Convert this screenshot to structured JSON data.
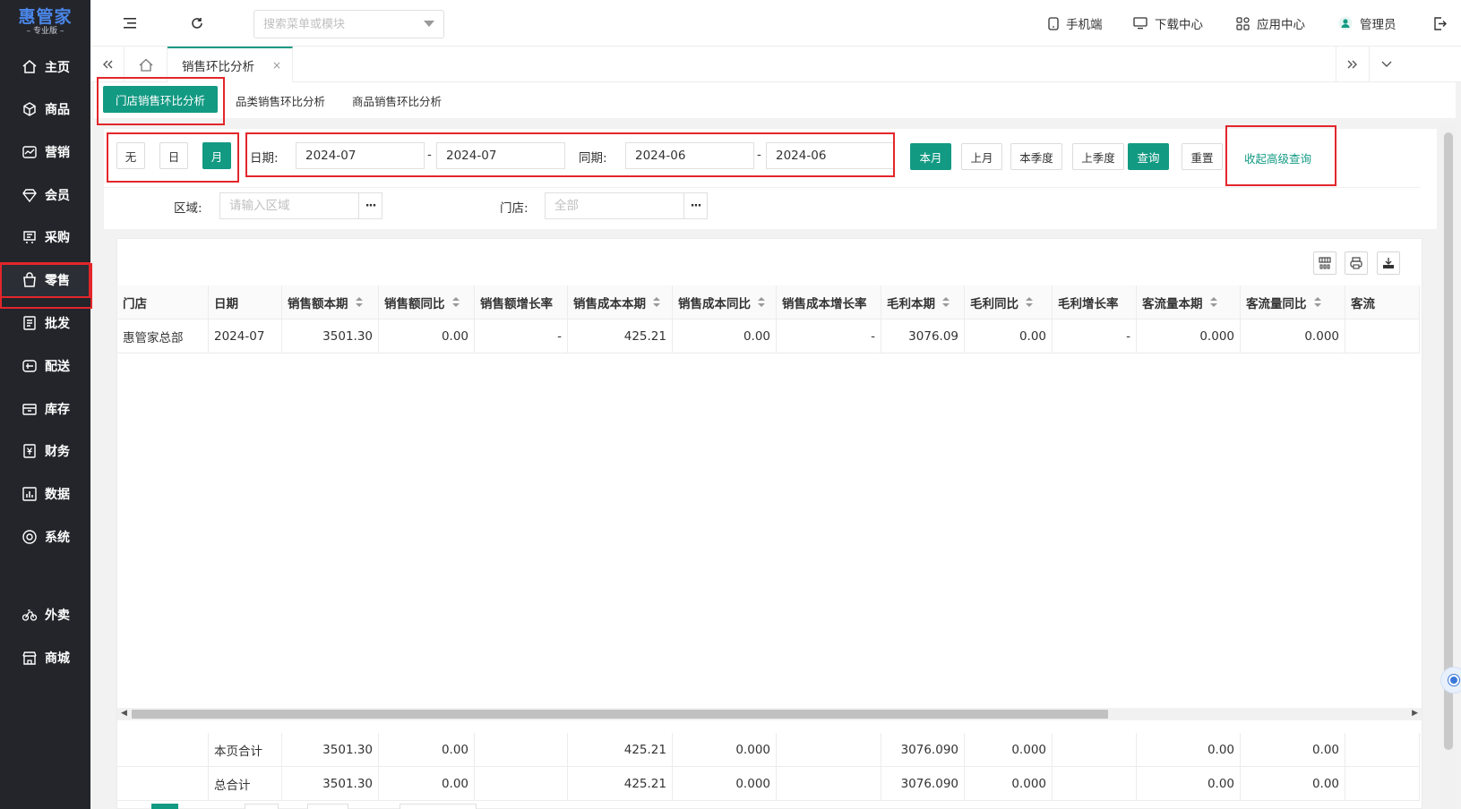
{
  "brand": {
    "name": "惠管家",
    "edition": "专业版"
  },
  "sidebar": {
    "items": [
      {
        "label": "主页",
        "icon": "home-icon"
      },
      {
        "label": "商品",
        "icon": "cube-icon"
      },
      {
        "label": "营销",
        "icon": "trend-icon"
      },
      {
        "label": "会员",
        "icon": "diamond-icon"
      },
      {
        "label": "采购",
        "icon": "purchase-icon"
      },
      {
        "label": "零售",
        "icon": "shopping-bag-icon",
        "active": true
      },
      {
        "label": "批发",
        "icon": "wholesale-icon"
      },
      {
        "label": "配送",
        "icon": "truck-icon"
      },
      {
        "label": "库存",
        "icon": "inventory-icon"
      },
      {
        "label": "财务",
        "icon": "yuan-icon"
      },
      {
        "label": "数据",
        "icon": "chart-icon"
      },
      {
        "label": "系统",
        "icon": "target-icon"
      },
      {
        "label": "外卖",
        "icon": "bike-icon"
      },
      {
        "label": "商城",
        "icon": "store-icon"
      }
    ]
  },
  "header": {
    "search_placeholder": "搜索菜单或模块",
    "mobile": "手机端",
    "download": "下载中心",
    "apps": "应用中心",
    "user": "管理员"
  },
  "tabs": {
    "active": "销售环比分析",
    "close": "×"
  },
  "subtabs": [
    "门店销售环比分析",
    "品类销售环比分析",
    "商品销售环比分析"
  ],
  "filter": {
    "granularity": [
      "无",
      "日",
      "月"
    ],
    "date_label": "日期:",
    "date_from": "2024-07",
    "date_to": "2024-07",
    "compare_label": "同期:",
    "compare_from": "2024-06",
    "compare_to": "2024-06",
    "dash": "-",
    "quick": [
      "本月",
      "上月",
      "本季度",
      "上季度"
    ],
    "query": "查询",
    "reset": "重置",
    "collapse": "收起高级查询",
    "region_label": "区域:",
    "region_placeholder": "请输入区域",
    "store_label": "门店:",
    "store_placeholder": "全部",
    "dots": "···"
  },
  "table": {
    "columns": [
      "门店",
      "日期",
      "销售额本期",
      "销售额同比",
      "销售额增长率",
      "销售成本本期",
      "销售成本同比",
      "销售成本增长率",
      "毛利本期",
      "毛利同比",
      "毛利增长率",
      "客流量本期",
      "客流量同比",
      "客流"
    ],
    "sortable": [
      false,
      false,
      true,
      true,
      false,
      true,
      true,
      false,
      true,
      true,
      false,
      true,
      true,
      false
    ],
    "rows": [
      [
        "惠管家总部",
        "2024-07",
        "3501.30",
        "0.00",
        "-",
        "425.21",
        "0.00",
        "-",
        "3076.09",
        "0.00",
        "-",
        "0.000",
        "0.000",
        ""
      ]
    ],
    "footer": [
      [
        "",
        "本页合计",
        "3501.30",
        "0.00",
        "",
        "425.21",
        "0.000",
        "",
        "3076.090",
        "0.000",
        "",
        "0.00",
        "0.00",
        ""
      ],
      [
        "",
        "总合计",
        "3501.30",
        "0.00",
        "",
        "425.21",
        "0.000",
        "",
        "3076.090",
        "0.000",
        "",
        "0.00",
        "0.00",
        ""
      ]
    ]
  },
  "colors": {
    "primary": "#139a83",
    "sidebar": "#23252b",
    "highlight": "#e3262b"
  }
}
